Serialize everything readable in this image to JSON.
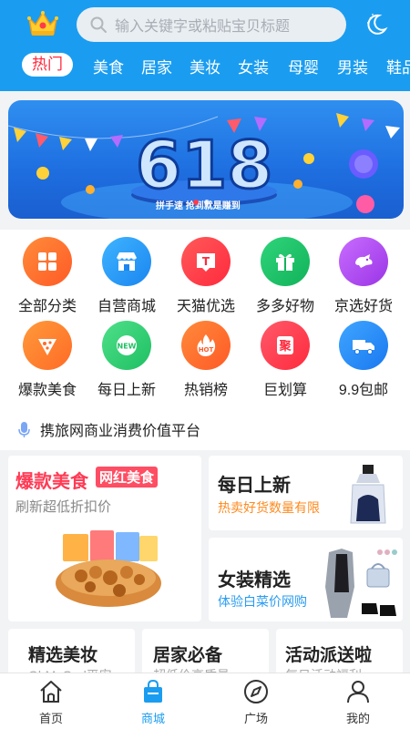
{
  "header": {
    "search_placeholder": "输入关键字或粘贴宝贝标题",
    "tabs": [
      "热门",
      "美食",
      "居家",
      "美妆",
      "女装",
      "母婴",
      "男装",
      "鞋品"
    ],
    "active_tab_color": "#ff2a3d",
    "brand_color": "#1a9df0"
  },
  "banner": {
    "caption": "拼手速 抢到就是赚到",
    "headline": "618",
    "dots": 2,
    "active_dot": 0
  },
  "categories": [
    {
      "label": "全部分类",
      "icon": "grid-icon",
      "color": "#ff6a2c"
    },
    {
      "label": "自营商城",
      "icon": "store-icon",
      "color": "#2a9cf0"
    },
    {
      "label": "天猫优选",
      "icon": "tmall-icon",
      "color": "#ff3c4a"
    },
    {
      "label": "多多好物",
      "icon": "gift-icon",
      "color": "#1fc16b"
    },
    {
      "label": "京选好货",
      "icon": "jd-dog-icon",
      "color": "#b84cf0"
    },
    {
      "label": "爆款美食",
      "icon": "food-icon",
      "color": "#ff7b2c"
    },
    {
      "label": "每日上新",
      "icon": "new-icon",
      "color": "#2ec86a"
    },
    {
      "label": "热销榜",
      "icon": "hot-icon",
      "color": "#ff6b2c"
    },
    {
      "label": "巨划算",
      "icon": "deal-icon",
      "color": "#ff3d4d"
    },
    {
      "label": "9.9包邮",
      "icon": "truck-icon",
      "color": "#2a8ff0"
    }
  ],
  "announcement": "携旅网商业消费价值平台",
  "promos": {
    "food": {
      "title": "爆款美食",
      "badge": "网红美食",
      "subtitle": "刷新超低折扣价"
    },
    "daily": {
      "title": "每日上新",
      "subtitle": "热卖好货数量有限"
    },
    "women": {
      "title": "女装精选",
      "subtitle": "体验白菜价网购"
    },
    "row": [
      {
        "title": "精选美妆",
        "subtitle": "OhMyGod平安"
      },
      {
        "title": "居家必备",
        "subtitle": "超低价高质量"
      },
      {
        "title": "活动派送啦",
        "subtitle": "每日活动福利"
      }
    ]
  },
  "bottom_nav": [
    {
      "label": "首页",
      "icon": "home-icon"
    },
    {
      "label": "商城",
      "icon": "mall-bag-icon"
    },
    {
      "label": "广场",
      "icon": "compass-icon"
    },
    {
      "label": "我的",
      "icon": "user-icon"
    }
  ],
  "active_nav": 1
}
